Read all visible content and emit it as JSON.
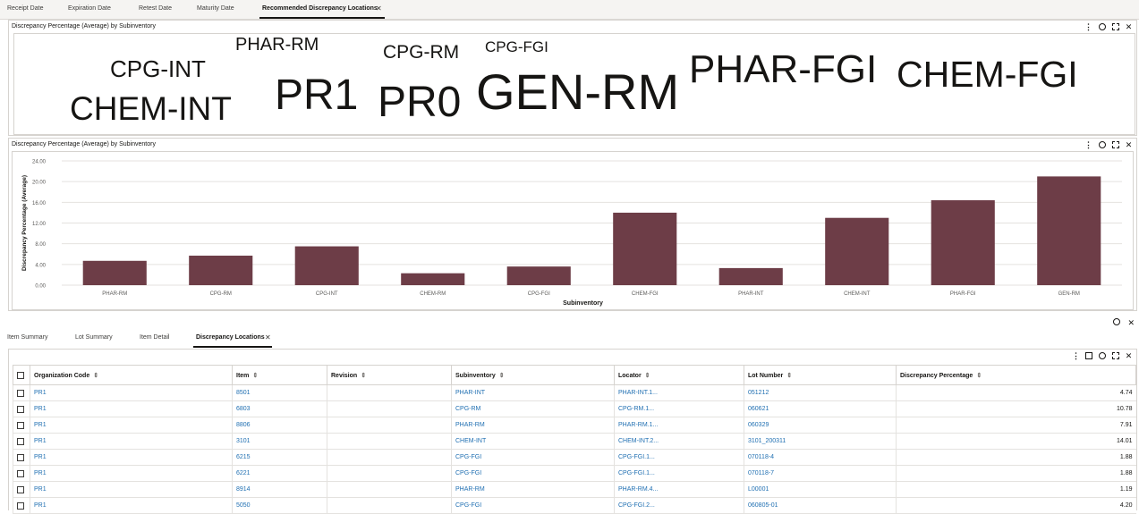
{
  "top_tabs": [
    "Receipt Date",
    "Expiration Date",
    "Retest Date",
    "Maturity Date",
    "Recommended Discrepancy Locations"
  ],
  "cloud_panel": {
    "title": "Discrepancy Percentage (Average) by Subinventory",
    "words": [
      "PHAR-RM",
      "CPG-RM",
      "CPG-FGI",
      "CPG-INT",
      "CHEM-INT",
      "PR1",
      "PR0",
      "GEN-RM",
      "PHAR-FGI",
      "CHEM-FGI"
    ]
  },
  "chart_panel": {
    "title": "Discrepancy Percentage (Average) by Subinventory"
  },
  "chart_data": {
    "type": "bar",
    "categories": [
      "PHAR-RM",
      "CPG-RM",
      "CPG-INT",
      "CHEM-RM",
      "CPG-FGI",
      "CHEM-FGI",
      "PHAR-INT",
      "CHEM-INT",
      "PHAR-FGI",
      "GEN-RM"
    ],
    "values": [
      4.7,
      5.7,
      7.5,
      2.3,
      3.6,
      14.0,
      3.3,
      13.0,
      16.4,
      21.0
    ],
    "xlabel": "Subinventory",
    "ylabel": "Discrepancy Percentage (Average)",
    "yticks": [
      "0.00",
      "4.00",
      "8.00",
      "12.00",
      "16.00",
      "20.00",
      "24.00"
    ],
    "ylim": [
      0,
      24
    ],
    "bar_color": "#6d3d47"
  },
  "sub_tabs": [
    "Item Summary",
    "Lot Summary",
    "Item Detail",
    "Discrepancy Locations"
  ],
  "table": {
    "columns": [
      "Organization Code",
      "Item",
      "Revision",
      "Subinventory",
      "Locator",
      "Lot Number",
      "Discrepancy Percentage"
    ],
    "rows": [
      [
        "PR1",
        "8501",
        "",
        "PHAR-INT",
        "PHAR-INT.1...",
        "051212",
        "4.74"
      ],
      [
        "PR1",
        "6803",
        "",
        "CPG-RM",
        "CPG-RM.1...",
        "060621",
        "10.78"
      ],
      [
        "PR1",
        "8806",
        "",
        "PHAR-RM",
        "PHAR-RM.1...",
        "060329",
        "7.91"
      ],
      [
        "PR1",
        "3101",
        "",
        "CHEM-INT",
        "CHEM-INT.2...",
        "3101_200311",
        "14.01"
      ],
      [
        "PR1",
        "6215",
        "",
        "CPG-FGI",
        "CPG-FGI.1...",
        "070118-4",
        "1.88"
      ],
      [
        "PR1",
        "6221",
        "",
        "CPG-FGI",
        "CPG-FGI.1...",
        "070118-7",
        "1.88"
      ],
      [
        "PR1",
        "8914",
        "",
        "PHAR-RM",
        "PHAR-RM.4...",
        "L00001",
        "1.19"
      ],
      [
        "PR1",
        "5050",
        "",
        "CPG-FGI",
        "CPG-FGI.2...",
        "060805-01",
        "4.20"
      ]
    ]
  }
}
